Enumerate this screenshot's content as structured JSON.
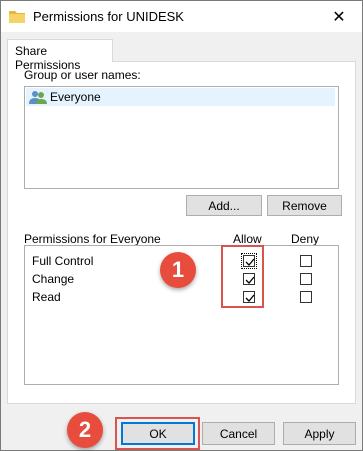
{
  "window": {
    "title": "Permissions for UNIDESK",
    "close_glyph": "✕"
  },
  "tabs": [
    {
      "label": "Share Permissions",
      "active": true
    }
  ],
  "groups": {
    "label": "Group or user names:",
    "items": [
      {
        "name": "Everyone",
        "icon": "users-icon",
        "selected": true
      }
    ]
  },
  "buttons": {
    "add": "Add...",
    "remove": "Remove",
    "ok": "OK",
    "cancel": "Cancel",
    "apply": "Apply"
  },
  "permissions": {
    "header": "Permissions for Everyone",
    "allow_header": "Allow",
    "deny_header": "Deny",
    "rows": [
      {
        "name": "Full Control",
        "allow": true,
        "deny": false
      },
      {
        "name": "Change",
        "allow": true,
        "deny": false
      },
      {
        "name": "Read",
        "allow": true,
        "deny": false
      }
    ]
  },
  "annotations": [
    {
      "number": "1",
      "color": "#e74c3c"
    },
    {
      "number": "2",
      "color": "#e74c3c"
    }
  ]
}
